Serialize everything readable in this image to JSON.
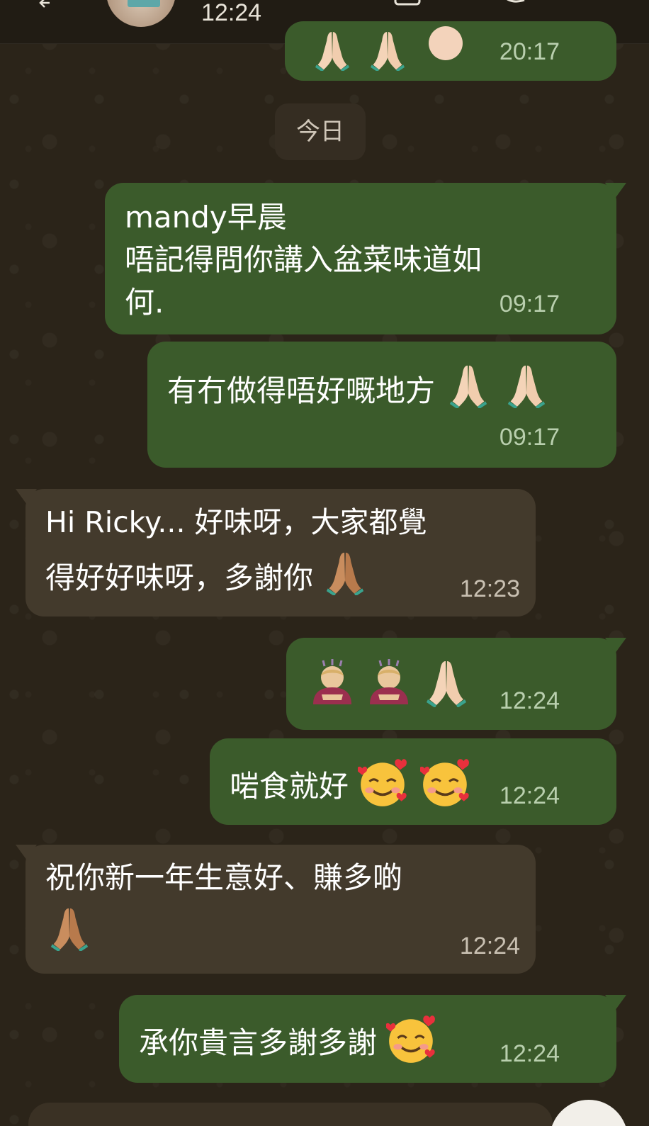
{
  "header": {
    "time": "12:24"
  },
  "date_divider": "今日",
  "messages": [
    {
      "id": "m0",
      "direction": "out",
      "time": "20:17",
      "status": "read"
    },
    {
      "id": "m1",
      "direction": "out",
      "line1": "mandy早晨",
      "line2": "唔記得問你講入盆菜味道如",
      "line3": "何.",
      "time": "09:17",
      "status": "read"
    },
    {
      "id": "m2",
      "direction": "out",
      "text": "有冇做得唔好嘅地方",
      "time": "09:17",
      "status": "read"
    },
    {
      "id": "m3",
      "direction": "in",
      "line1": "Hi Ricky... 好味呀，大家都覺",
      "line2": "得好好味呀，多謝你",
      "time": "12:23"
    },
    {
      "id": "m4",
      "direction": "out",
      "time": "12:24",
      "status": "read"
    },
    {
      "id": "m5",
      "direction": "out",
      "text": "啱食就好",
      "time": "12:24",
      "status": "read"
    },
    {
      "id": "m6",
      "direction": "in",
      "line1": "祝你新一年生意好、賺多啲",
      "time": "12:24"
    },
    {
      "id": "m7",
      "direction": "out",
      "text": "承你貴言多謝多謝",
      "time": "12:24",
      "status": "sent"
    }
  ],
  "icons": {
    "back": "back-arrow-icon",
    "praying": "folded-hands-emoji",
    "bowing": "person-bowing-emoji",
    "smiling_hearts": "smiling-face-with-hearts-emoji",
    "read_receipt": "double-check-icon"
  },
  "colors": {
    "background": "#2b2419",
    "outgoing_bubble": "#3b5b2b",
    "incoming_bubble": "#433a2c",
    "read_tick": "#53bdeb"
  }
}
